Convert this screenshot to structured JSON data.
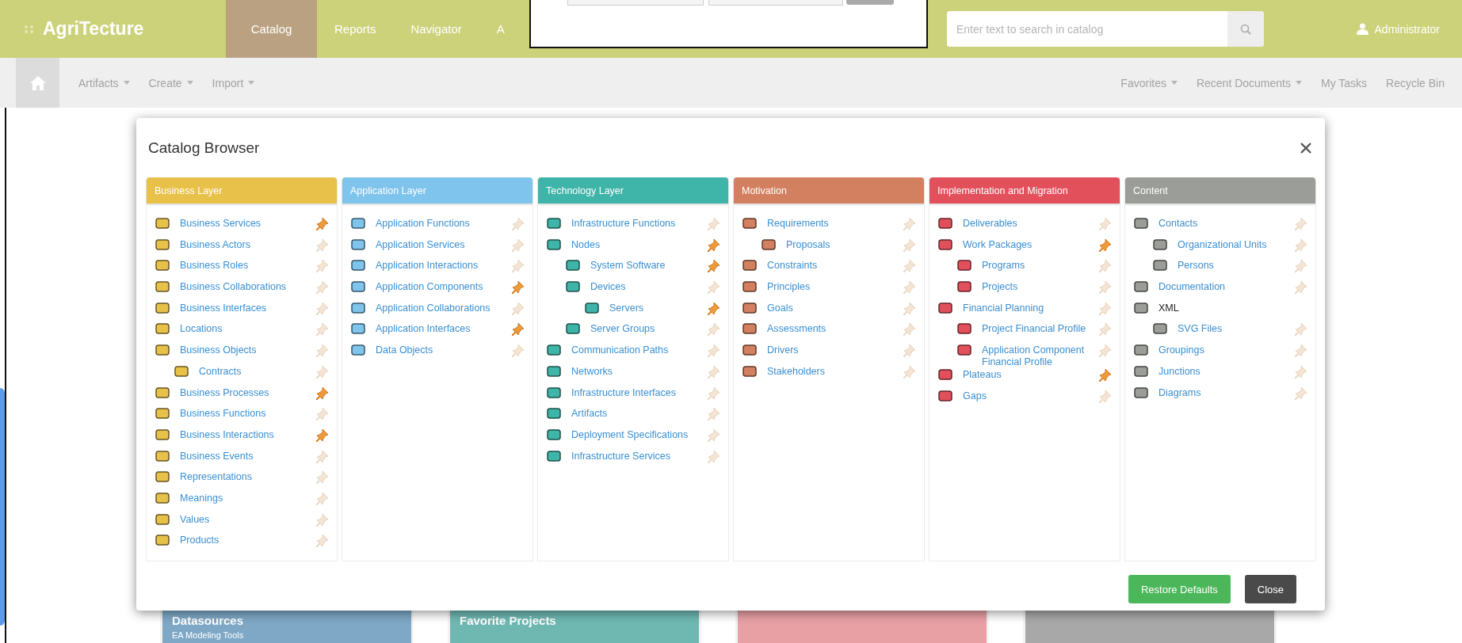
{
  "app": {
    "logo": "AgriTecture",
    "nav": [
      {
        "label": "Catalog",
        "selected": true
      },
      {
        "label": "Reports",
        "selected": false
      },
      {
        "label": "Navigator",
        "selected": false
      },
      {
        "label": "A",
        "selected": false
      }
    ],
    "search": {
      "placeholder": "Enter text to search in catalog"
    },
    "user": {
      "name": "Administrator"
    }
  },
  "toolbar": {
    "left": [
      {
        "label": "Artifacts",
        "dropdown": true
      },
      {
        "label": "Create",
        "dropdown": true
      },
      {
        "label": "Import",
        "dropdown": true
      }
    ],
    "right": [
      {
        "label": "Favorites",
        "dropdown": true
      },
      {
        "label": "Recent Documents",
        "dropdown": true
      },
      {
        "label": "My Tasks",
        "dropdown": false
      },
      {
        "label": "Recycle Bin",
        "dropdown": false
      }
    ]
  },
  "catalog_browser": {
    "title": "Catalog Browser",
    "columns": [
      {
        "title": "Business Layer",
        "color": "#e8c14b",
        "items": [
          {
            "label": "Business Services",
            "pinned": true
          },
          {
            "label": "Business Actors",
            "pinned": false
          },
          {
            "label": "Business Roles",
            "pinned": false
          },
          {
            "label": "Business Collaborations",
            "pinned": false
          },
          {
            "label": "Business Interfaces",
            "pinned": false
          },
          {
            "label": "Locations",
            "pinned": false
          },
          {
            "label": "Business Objects",
            "pinned": false,
            "children": [
              {
                "label": "Contracts",
                "pinned": false
              }
            ]
          },
          {
            "label": "Business Processes",
            "pinned": true
          },
          {
            "label": "Business Functions",
            "pinned": false
          },
          {
            "label": "Business Interactions",
            "pinned": true
          },
          {
            "label": "Business Events",
            "pinned": false
          },
          {
            "label": "Representations",
            "pinned": false
          },
          {
            "label": "Meanings",
            "pinned": false
          },
          {
            "label": "Values",
            "pinned": false
          },
          {
            "label": "Products",
            "pinned": false
          }
        ]
      },
      {
        "title": "Application Layer",
        "color": "#7fc4ec",
        "items": [
          {
            "label": "Application Functions",
            "pinned": false
          },
          {
            "label": "Application Services",
            "pinned": false
          },
          {
            "label": "Application Interactions",
            "pinned": false
          },
          {
            "label": "Application Components",
            "pinned": true
          },
          {
            "label": "Application Collaborations",
            "pinned": false
          },
          {
            "label": "Application Interfaces",
            "pinned": true
          },
          {
            "label": "Data Objects",
            "pinned": false
          }
        ]
      },
      {
        "title": "Technology Layer",
        "color": "#3fb4a8",
        "items": [
          {
            "label": "Infrastructure Functions",
            "pinned": false
          },
          {
            "label": "Nodes",
            "pinned": true,
            "children": [
              {
                "label": "System Software",
                "pinned": true
              },
              {
                "label": "Devices",
                "pinned": false,
                "children": [
                  {
                    "label": "Servers",
                    "pinned": true
                  }
                ]
              },
              {
                "label": "Server Groups",
                "pinned": false
              }
            ]
          },
          {
            "label": "Communication Paths",
            "pinned": false
          },
          {
            "label": "Networks",
            "pinned": false
          },
          {
            "label": "Infrastructure Interfaces",
            "pinned": false
          },
          {
            "label": "Artifacts",
            "pinned": false
          },
          {
            "label": "Deployment Specifications",
            "pinned": false
          },
          {
            "label": "Infrastructure Services",
            "pinned": false
          }
        ]
      },
      {
        "title": "Motivation",
        "color": "#d2805f",
        "items": [
          {
            "label": "Requirements",
            "pinned": false,
            "children": [
              {
                "label": "Proposals",
                "pinned": false
              }
            ]
          },
          {
            "label": "Constraints",
            "pinned": false
          },
          {
            "label": "Principles",
            "pinned": false
          },
          {
            "label": "Goals",
            "pinned": false
          },
          {
            "label": "Assessments",
            "pinned": false
          },
          {
            "label": "Drivers",
            "pinned": false
          },
          {
            "label": "Stakeholders",
            "pinned": false
          }
        ]
      },
      {
        "title": "Implementation and Migration",
        "color": "#e2505c",
        "items": [
          {
            "label": "Deliverables",
            "pinned": false
          },
          {
            "label": "Work Packages",
            "pinned": true,
            "children": [
              {
                "label": "Programs",
                "pinned": false
              },
              {
                "label": "Projects",
                "pinned": false
              }
            ]
          },
          {
            "label": "Financial Planning",
            "pinned": false,
            "children": [
              {
                "label": "Project Financial Profile",
                "pinned": false
              },
              {
                "label": "Application Component Financial Profile",
                "pinned": false
              }
            ]
          },
          {
            "label": "Plateaus",
            "pinned": true
          },
          {
            "label": "Gaps",
            "pinned": false
          }
        ]
      },
      {
        "title": "Content",
        "color": "#9a9d98",
        "items": [
          {
            "label": "Contacts",
            "pinned": false,
            "children": [
              {
                "label": "Organizational Units",
                "pinned": false
              },
              {
                "label": "Persons",
                "pinned": false
              }
            ]
          },
          {
            "label": "Documentation",
            "pinned": false
          },
          {
            "label": "XML",
            "children": [
              {
                "label": "SVG Files",
                "pinned": false
              }
            ]
          },
          {
            "label": "Groupings",
            "pinned": false
          },
          {
            "label": "Junctions",
            "pinned": false
          },
          {
            "label": "Diagrams",
            "pinned": false
          }
        ]
      }
    ],
    "buttons": [
      {
        "label": "Restore Defaults",
        "kind": "primary"
      },
      {
        "label": "Close",
        "kind": "secondary"
      }
    ]
  },
  "tiles": [
    {
      "title": "Datasources",
      "subtitle": "EA Modeling Tools",
      "color": "#7ea8c6"
    },
    {
      "title": "Favorite Projects",
      "color": "#6fb8b2"
    },
    {
      "color": "#e8a0a5"
    },
    {
      "color": "#a8a8a8"
    }
  ]
}
